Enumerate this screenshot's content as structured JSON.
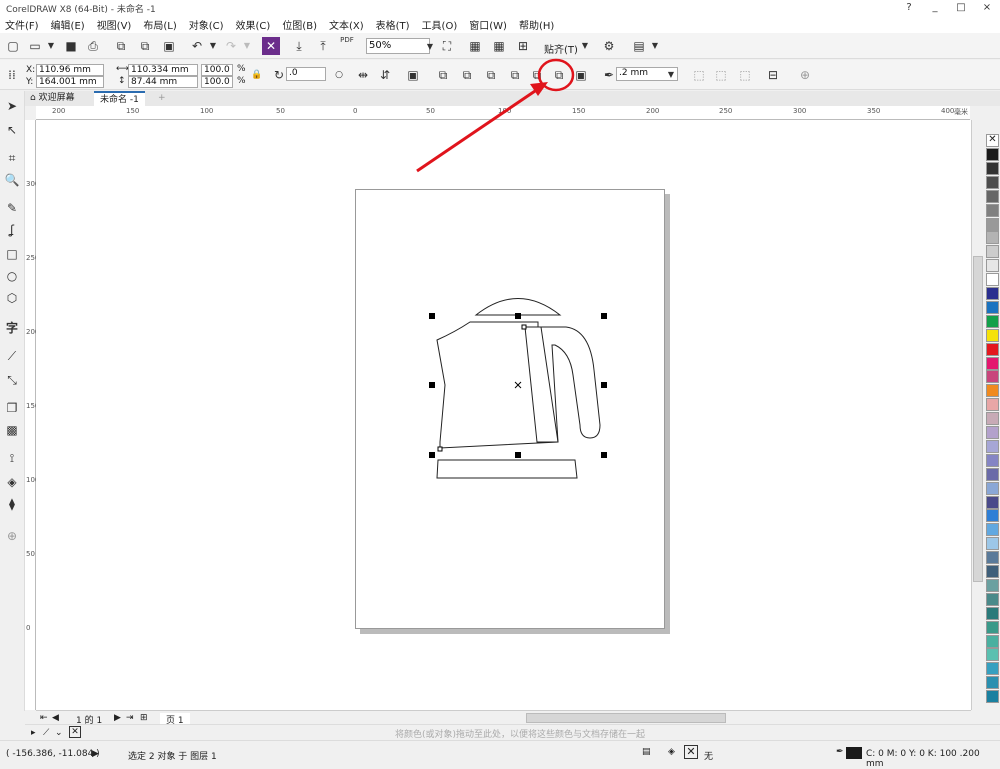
{
  "window": {
    "title": "CorelDRAW X8 (64-Bit) - 未命名 -1",
    "controls": [
      "?",
      "_",
      "□",
      "×"
    ]
  },
  "menu": [
    "文件(F)",
    "编辑(E)",
    "视图(V)",
    "布局(L)",
    "对象(C)",
    "效果(C)",
    "位图(B)",
    "文本(X)",
    "表格(T)",
    "工具(O)",
    "窗口(W)",
    "帮助(H)"
  ],
  "toolbar": {
    "zoom": "50%",
    "snap_label": "贴齐(T)",
    "pdf_label": "PDF"
  },
  "propbar": {
    "x_label": "X:",
    "x": "110.96 mm",
    "y_label": "Y:",
    "y": "164.001 mm",
    "w": "110.334 mm",
    "h": "87.44 mm",
    "sx": "100.0",
    "sy": "100.0",
    "pct": "%",
    "angle": ".0",
    "outline": ".2 mm"
  },
  "tabs": {
    "welcome": "欢迎屏幕",
    "doc": "未命名 -1",
    "add": "+"
  },
  "ruler": {
    "h_ticks": [
      "200",
      "150",
      "100",
      "50",
      "0",
      "50",
      "100",
      "150",
      "200",
      "250",
      "300",
      "350",
      "400"
    ],
    "unit": "毫米",
    "v_ticks": [
      "300",
      "250",
      "200",
      "150",
      "100",
      "50",
      "0"
    ]
  },
  "pagenav": {
    "page_count": "1 的 1",
    "page_tab": "页 1"
  },
  "palette_hint": "将颜色(或对象)拖动至此处，以便将这些颜色与文档存储在一起",
  "status": {
    "coords": "( -156.386, -11.084 )",
    "selection": "选定 2 对象 于 图层 1",
    "fill": "无",
    "outline": "C: 0 M: 0 Y: 0 K: 100  .200 mm"
  },
  "colors": {
    "accent_red": "#e0141c",
    "palette": [
      "#1a1a1a",
      "#333333",
      "#4d4d4d",
      "#666666",
      "#808080",
      "#999999",
      "#b3b3b3",
      "#cccccc",
      "#e6e6e6",
      "#ffffff",
      "#2b2f8f",
      "#1b73c0",
      "#12a04a",
      "#f5e20a",
      "#e4181f",
      "#e4176f",
      "#c8467c",
      "#f08a1f",
      "#e8a6a6",
      "#c7aab6",
      "#b3a1cc",
      "#a6a6d6",
      "#8585c4",
      "#6a6aa8",
      "#8aa7d6",
      "#4a4a8a",
      "#2f7fd6",
      "#61a8e0",
      "#9cc7e8",
      "#5a7a9a",
      "#3f5f7a",
      "#6aa0a0",
      "#4a8a8a",
      "#2a7a7a",
      "#3a9a8a",
      "#4ab0a0",
      "#5ac0b0",
      "#36a0c0",
      "#2a90b0",
      "#1a80a0"
    ]
  }
}
